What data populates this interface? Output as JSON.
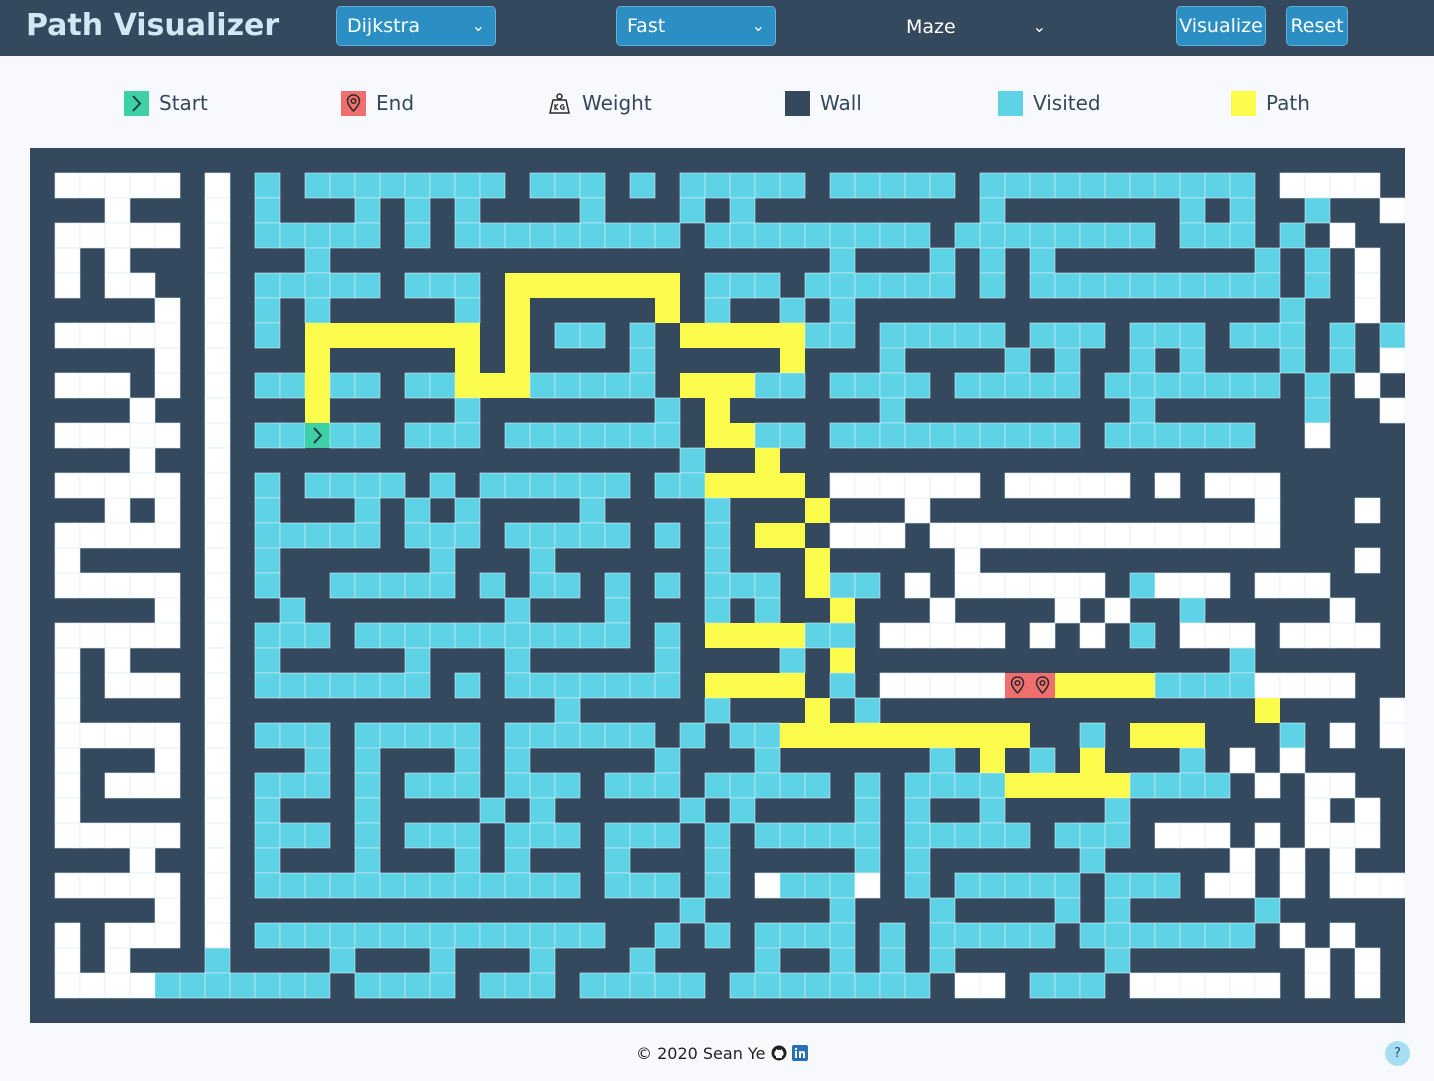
{
  "app": {
    "title": "Path Visualizer"
  },
  "toolbar": {
    "algorithm": "Dijkstra",
    "speed": "Fast",
    "maze": "Maze",
    "visualize_label": "Visualize",
    "reset_label": "Reset",
    "chevron": "⌄"
  },
  "legend": {
    "start": "Start",
    "end": "End",
    "weight": "Weight",
    "wall": "Wall",
    "visited": "Visited",
    "path": "Path"
  },
  "colors": {
    "navbar": "#34495e",
    "wall": "#34495e",
    "empty": "#ffffff",
    "visited": "#5fd3e6",
    "path": "#fcfc4d",
    "start": "#3ed1a7",
    "end": "#ef6f6f",
    "button": "#2b8fc4"
  },
  "grid": {
    "rows": 35,
    "cols": 55,
    "start": [
      11,
      11
    ],
    "end": [
      21,
      40
    ],
    "cells": [
      "WWWWWWWWWWWWWWWWWWWWWWWWWWWWWWWWWWWWWWWWWWWWWWWWWWWWWWW",
      "WEEEEEWEWVWVVVVVVVVWVVVWVWVVVVVWVVVVVWVVVVVVVVVVVWEEEEW",
      "WWWEWWWEWVWWWVWVWVWWWWVWWWVWVWWWWWWWWWVWWWWWWWVWVWWVWWEW",
      "WEEEEEWEWVVVVVWVWVVVVVVVVVWVVVVVVVVVWVVVVVVVVWVVVWVWEW",
      "WEWEWWWEWWWVWWWWWWWWWWWWWWWWWWWWVWWWVWVWVWWWWWWWWVWVWEW",
      "WEWEEWWEWVVVVVWVVVWPPPPPPPWVVVWVVVVVVWVWVVVVVVVVVVWVWEW",
      "WWWWWEWEWVWVWWWWWVWPWWWWWPWVWWVWVWWWWWWWWWWWWWWWWWVWWEW",
      "WEEEEEWEWVWPPPPPPPWPWVVWVWPPPPPVVWVVVVVWVVVWVVVWVVVWVWVWEW",
      "WWWWWEWEWWWPWWWWWPWPWWWWVWWWWWPWWWVWWWWVWVWWVWVWWWVWVWEW",
      "WEEEWEWEWVVPVVWVVPPPVVVVVWPPPVVWVVVVWVVVVVWVVVVVVVWVWEW",
      "WWWWEWWEWWWPWWWWWVWWWWWWWVWPWWWWWWVWWWWWWWWWVWWWWWWVWWEW",
      "WEEEEEWEWVVSVVWVVVWVVVVVVVWPPVVWVVVVVVVVVVWVVVVVVWWEW",
      "WWWWEWWEWWWWWWWWWWWWWWWWWWVWWPWWWWWWWWWWWWWWWWWWWWWWWWW",
      "WEEEEEWEWVWVVVVWVWVVVVVVWVVPPPPWEEEEEEWEEEEEWEWEEEW",
      "WWWEWEWEWVWWWVWVWVWWWWVWWWWVWWWPWWWEWWWWWWWWWWWWWEWWWEW",
      "WEEEEEWEWVVVVVWVVVWVVVVVWVWVWPPWEEEWEEEEEEEEEEEEEEW",
      "WEWWWWWEWVWWWWWWVWWWVWWWWWWVWWWPWWWWWEWWWWWWWWWWWWWWWEW",
      "WEEEEEWEWVWWVVVVVWVWVVWVWVWVVVWPVVWEWEEEEEEWVEEEWEEEW",
      "WWWWWEWEWWVWWWWWWWWVWWWVWWWVWVWWPWWWEWWWWEWEWWVWWWWWEWW",
      "WEEEEEWEWVVVWVVVVVVVVVVVWVWPPPPVVWEEEEEWEWEWVWEEEWEEEEW",
      "WEWEWWWEWVWWWWWVWWWVWWWWWVWWWWVWPWWWWWWWWWWWWWWWVWWWWWWEW",
      "WEWEEEWEWVVVVVVVWVWVVVVVVVWPPPPWVWEEEEEOPPPPPVVVVEEEEW",
      "WEWWWWWEWWWWWWWWWWWWWVWWWWWVWWWPWVWWWWWWWWWWWWWWWPWWWWEWEW",
      "WEEEEEWEWVVVWVVVVVWVVVVVVWVWVVPPPPPPPPPPWWVWPPPWWWVWEWEEW",
      "WEWWWEWEWWWVWVWWWVWVWWWWWVWWWVWWWWWWVWPWVWPWWWVWEWEWWW",
      "WEWEEEWEWVVVWVWVVVWVVVWVVVWVVVVVWVWVVVVPPPPPVVVVWEWEEW",
      "WEWWWWWEWVWWWVWWWWVWVWWWWWVWVWWWWVWVWWVWWWWVWWWWWWWEWEWW",
      "WEEEEEWEWVVVWVWVVVWVVVWVVVWVWVVVVVWVVVVVWVVVWEEEWEWEEEW",
      "WWWWEWWEWVWWWVWWWVWVWWWVWWWVWWWWWVWVWWWWWWVWWWWWEWEWEWW",
      "WEEEEEWEWVVVVVVVVVVVVVWVVVWVWEVVVEWVWVVVVVWVVVWEEWEWEEEW",
      "WWWWWEWEWWWWWWWWWWWWWWWWWWVWWWWWVWWWVWWWWVWVWWWWWVWWWWWEWEWW",
      "WEWEEEWEWVVVVVVVVVVVVVVWWVWVWVVVVWVWVVVVVWVVVVVVVWEWEW",
      "WEWEWWWVWWWWVWWWVWWWVWWWVWWWWVWWVWVWVWWWWWWVWWWWWWWEWEWEWW",
      "WEEEEVVVVVVVWVVVVWVVVWVVVVVWVVVVVVVVWEEWVVVWEEEEEEWEWEW",
      "WWWWWWWWWWWWWWWWWWWWWWWWWWWWWWWWWWWWWWWWWWWWWWWWWWWWWWW"
    ]
  },
  "footer": {
    "copyright": "© 2020 Sean Ye"
  },
  "help": {
    "label": "?"
  }
}
